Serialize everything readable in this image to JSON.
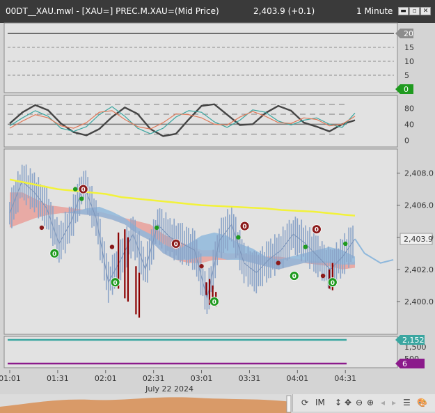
{
  "title": {
    "chart_name": "00DT__XAU.mwl - [XAU=] PREC.M.XAU=(Mid Price)",
    "price": "2,403.9 (+0.1)",
    "interval": "1 Minute"
  },
  "window_buttons": [
    "minimize",
    "restore",
    "close"
  ],
  "colors": {
    "background": "#d4d4d4",
    "ma_yellow": "#f2f23a",
    "cloud_red": "#e9a09a",
    "cloud_blue": "#8fb8dc",
    "bars": "#8ba4c8",
    "spikes": "#8b0000",
    "signal_green": "#1f9a1f",
    "signal_red": "#8b1a1a",
    "teal_line": "#3aa6a0",
    "purple_line": "#8b1a8b",
    "volume_fill": "#d99a68"
  },
  "chart_data": [
    {
      "type": "line",
      "panel": "top indicator",
      "yticks": [
        0,
        5,
        10,
        15,
        20
      ],
      "ylim": [
        0,
        22
      ],
      "series": [
        {
          "values": [
            20,
            20
          ]
        }
      ],
      "markers": [
        {
          "label": "20",
          "value": 20,
          "color": "#8c8c8c"
        },
        {
          "label": "0",
          "value": 0,
          "color": "#1f9a1f"
        }
      ]
    },
    {
      "type": "line",
      "panel": "oscillator",
      "yticks": [
        0,
        40,
        80
      ],
      "ylim": [
        -10,
        100
      ],
      "reference_levels": [
        15,
        40,
        65,
        90
      ],
      "x": [
        0,
        8,
        16,
        24,
        32,
        40,
        48,
        56,
        64,
        72,
        80,
        88,
        96,
        104,
        112,
        120,
        128,
        136,
        144,
        152,
        160,
        168,
        176,
        184,
        192,
        200,
        208,
        216
      ],
      "series": [
        {
          "values": [
            42,
            70,
            88,
            75,
            42,
            20,
            12,
            28,
            58,
            82,
            66,
            28,
            10,
            16,
            52,
            86,
            90,
            64,
            38,
            40,
            68,
            86,
            74,
            44,
            34,
            22,
            40,
            50
          ],
          "color": "#444444"
        },
        {
          "values": [
            36,
            56,
            74,
            60,
            30,
            22,
            34,
            64,
            84,
            60,
            30,
            16,
            30,
            58,
            74,
            70,
            46,
            32,
            50,
            76,
            70,
            48,
            38,
            50,
            56,
            40,
            32,
            68
          ],
          "color": "#3aa6a0"
        },
        {
          "values": [
            30,
            48,
            64,
            56,
            36,
            30,
            44,
            70,
            74,
            52,
            34,
            28,
            44,
            66,
            64,
            56,
            40,
            38,
            58,
            72,
            60,
            44,
            42,
            56,
            52,
            36,
            40,
            60
          ],
          "color": "#e07a5a"
        }
      ]
    },
    {
      "type": "line",
      "panel": "price",
      "yticks": [
        2400.0,
        2402.0,
        2404.0,
        2406.0,
        2408.0
      ],
      "ytick_labels": [
        "2,400.0",
        "2,402.0",
        "2,404.0",
        "2,406.0",
        "2,408.0"
      ],
      "ylim": [
        2398.8,
        2409.2
      ],
      "current_price_label": "2,403.9",
      "current_price": 2403.9,
      "x_minutes": [
        0,
        10,
        20,
        30,
        40,
        50,
        60,
        70,
        80,
        90,
        100,
        110,
        120,
        130,
        140,
        150,
        160,
        170,
        180,
        190,
        200,
        210,
        216
      ],
      "series": [
        {
          "name": "ma",
          "values": [
            2407.6,
            2407.4,
            2407.2,
            2407.0,
            2406.9,
            2406.8,
            2406.7,
            2406.5,
            2406.4,
            2406.3,
            2406.2,
            2406.1,
            2406.0,
            2405.95,
            2405.9,
            2405.85,
            2405.8,
            2405.7,
            2405.65,
            2405.6,
            2405.5,
            2405.4,
            2405.35
          ]
        },
        {
          "name": "price",
          "values": [
            2405.5,
            2407.5,
            2406.8,
            2405.8,
            2403.6,
            2405.0,
            2407.3,
            2405.2,
            2401.2,
            2402.6,
            2404.2,
            2402.0,
            2404.8,
            2404.0,
            2403.6,
            2403.2,
            2400.2,
            2403.8,
            2404.8,
            2402.4,
            2401.8,
            2402.6,
            2403.2,
            2404.2,
            2403.6,
            2402.8,
            2402.0,
            2402.8,
            2403.9
          ]
        }
      ],
      "bar_x_minutes": [
        0,
        8,
        16,
        24,
        32,
        40,
        48,
        56,
        64,
        72,
        80,
        88,
        96,
        104,
        112,
        120,
        128,
        136,
        144,
        152,
        160,
        168,
        176,
        184,
        192,
        200,
        208,
        216
      ],
      "clouds": [
        {
          "color": "red",
          "upper": [
            2406.8,
            2406.8,
            2406.4,
            2406.0,
            2405.9,
            2405.8,
            2405.7,
            2405.6,
            2405.4,
            2405.2,
            2405.0,
            2404.8,
            2404.2,
            2403.8,
            2403.5,
            2403.2,
            2403.2,
            2403.0,
            2403.0,
            2402.9,
            2402.8,
            2402.8,
            2402.7,
            2402.6,
            2402.5,
            2402.5,
            2402.3,
            2402.5
          ],
          "lower": [
            2404.6,
            2404.9,
            2405.2,
            2405.4,
            2405.5,
            2405.5,
            2405.4,
            2405.3,
            2405.1,
            2404.8,
            2404.2,
            2403.8,
            2403.0,
            2402.6,
            2402.4,
            2402.4,
            2402.6,
            2402.6,
            2402.7,
            2402.4,
            2402.2,
            2402.0,
            2402.2,
            2402.4,
            2402.3,
            2402.2,
            2402.0,
            2402.1
          ]
        },
        {
          "color": "blue",
          "upper": [
            2404.6,
            2404.9,
            2405.2,
            2405.4,
            2405.5,
            2405.6,
            2405.8,
            2405.9,
            2405.6,
            2405.2,
            2404.6,
            2404.2,
            2403.6,
            2403.2,
            2403.6,
            2404.1,
            2404.3,
            2404.1,
            2403.6,
            2403.3,
            2402.8,
            2402.6,
            2402.8,
            2403.0,
            2403.2,
            2403.4,
            2403.2,
            2402.8
          ],
          "lower": [
            2404.6,
            2404.9,
            2405.2,
            2405.4,
            2405.5,
            2405.5,
            2405.4,
            2405.3,
            2405.1,
            2404.8,
            2404.2,
            2403.8,
            2403.0,
            2402.6,
            2402.6,
            2402.8,
            2402.8,
            2402.6,
            2402.6,
            2402.4,
            2402.2,
            2402.0,
            2402.2,
            2402.4,
            2402.4,
            2402.4,
            2402.3,
            2402.3
          ]
        }
      ],
      "signals_up": [
        {
          "minute": 28,
          "price": 2403.0,
          "label": "0"
        },
        {
          "minute": 66,
          "price": 2401.2,
          "label": "0"
        },
        {
          "minute": 128,
          "price": 2400.0,
          "label": "0"
        },
        {
          "minute": 178,
          "price": 2401.6,
          "label": "0"
        },
        {
          "minute": 202,
          "price": 2401.2,
          "label": "0"
        }
      ],
      "signals_down": [
        {
          "minute": 46,
          "price": 2407.0,
          "label": "0"
        },
        {
          "minute": 104,
          "price": 2403.6,
          "label": "0"
        },
        {
          "minute": 147,
          "price": 2404.7,
          "label": "0"
        },
        {
          "minute": 192,
          "price": 2404.5,
          "label": "0"
        }
      ],
      "dots_green": [
        {
          "minute": 41,
          "price": 2407.0
        },
        {
          "minute": 45,
          "price": 2406.4
        },
        {
          "minute": 92,
          "price": 2404.6
        },
        {
          "minute": 143,
          "price": 2404.0
        },
        {
          "minute": 185,
          "price": 2403.4
        },
        {
          "minute": 210,
          "price": 2403.6
        }
      ],
      "dots_red": [
        {
          "minute": 20,
          "price": 2404.6
        },
        {
          "minute": 64,
          "price": 2403.4
        },
        {
          "minute": 120,
          "price": 2402.2
        },
        {
          "minute": 168,
          "price": 2402.4
        },
        {
          "minute": 196,
          "price": 2401.6
        }
      ],
      "spikes": [
        {
          "minute": 68,
          "top": 2404.3,
          "bottom": 2400.8
        },
        {
          "minute": 72,
          "top": 2404.5,
          "bottom": 2400.2
        },
        {
          "minute": 74,
          "top": 2404.0,
          "bottom": 2400.0
        },
        {
          "minute": 79,
          "top": 2402.2,
          "bottom": 2399.2
        },
        {
          "minute": 81,
          "top": 2401.8,
          "bottom": 2399.0
        },
        {
          "minute": 123,
          "top": 2401.2,
          "bottom": 2400.4
        },
        {
          "minute": 125,
          "top": 2401.4,
          "bottom": 2399.8
        },
        {
          "minute": 127,
          "top": 2401.0,
          "bottom": 2399.9
        },
        {
          "minute": 129,
          "top": 2400.6,
          "bottom": 2399.7
        },
        {
          "minute": 200,
          "top": 2402.0,
          "bottom": 2400.8
        },
        {
          "minute": 202,
          "top": 2402.4,
          "bottom": 2400.7
        }
      ]
    },
    {
      "type": "line",
      "panel": "bottom indicator",
      "yticks": [
        1500,
        500
      ],
      "ytick_labels": [
        "1,500",
        "500"
      ],
      "series": [
        {
          "color": "#3aa6a0",
          "values": [
            2152,
            2152
          ]
        },
        {
          "color": "#8b1a8b",
          "values": [
            6,
            6
          ]
        }
      ],
      "markers": [
        {
          "label": "2,152",
          "color": "#3aa6a0"
        },
        {
          "label": "6",
          "color": "#8b1a8b"
        }
      ]
    }
  ],
  "x_axis": {
    "tick_labels": [
      "01:01",
      "01:31",
      "02:01",
      "02:31",
      "03:01",
      "03:31",
      "04:01",
      "04:31"
    ],
    "tick_minutes": [
      0,
      30,
      60,
      90,
      120,
      150,
      180,
      210
    ],
    "date_label": "July 22 2024"
  },
  "toolbar": {
    "im_label": "IM"
  }
}
